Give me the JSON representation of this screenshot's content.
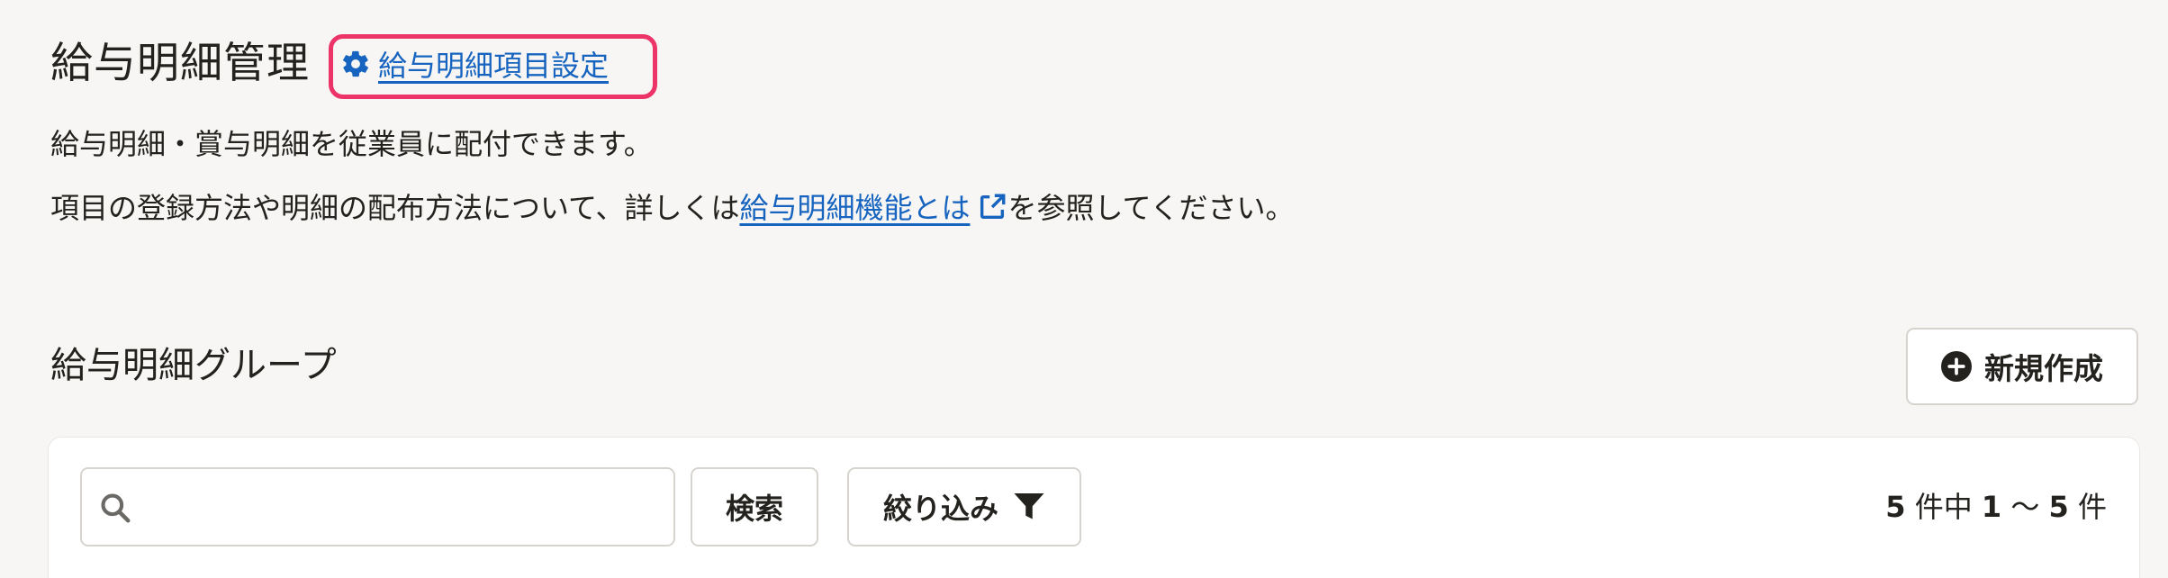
{
  "header": {
    "title": "給与明細管理",
    "settings_link": "給与明細項目設定"
  },
  "description": {
    "line1": "給与明細・賞与明細を従業員に配付できます。",
    "line2_prefix": "項目の登録方法や明細の配布方法について、詳しくは",
    "line2_link": "給与明細機能とは",
    "line2_suffix": "を参照してください。"
  },
  "section": {
    "title": "給与明細グループ",
    "new_button": "新規作成"
  },
  "toolbar": {
    "search_placeholder": "",
    "search_value": "",
    "search_button": "検索",
    "filter_button": "絞り込み"
  },
  "pagination": {
    "total": "5",
    "total_suffix": "件中",
    "range_start": "1",
    "range_separator": "〜",
    "range_end": "5",
    "range_suffix": "件"
  },
  "colors": {
    "link": "#1764c0",
    "highlight": "#ec3468",
    "text": "#23221e",
    "background": "#f7f6f4"
  },
  "icons": {
    "settings": "gear-icon",
    "external": "external-link-icon",
    "new": "plus-circle-icon",
    "search": "search-icon",
    "filter": "filter-icon"
  }
}
